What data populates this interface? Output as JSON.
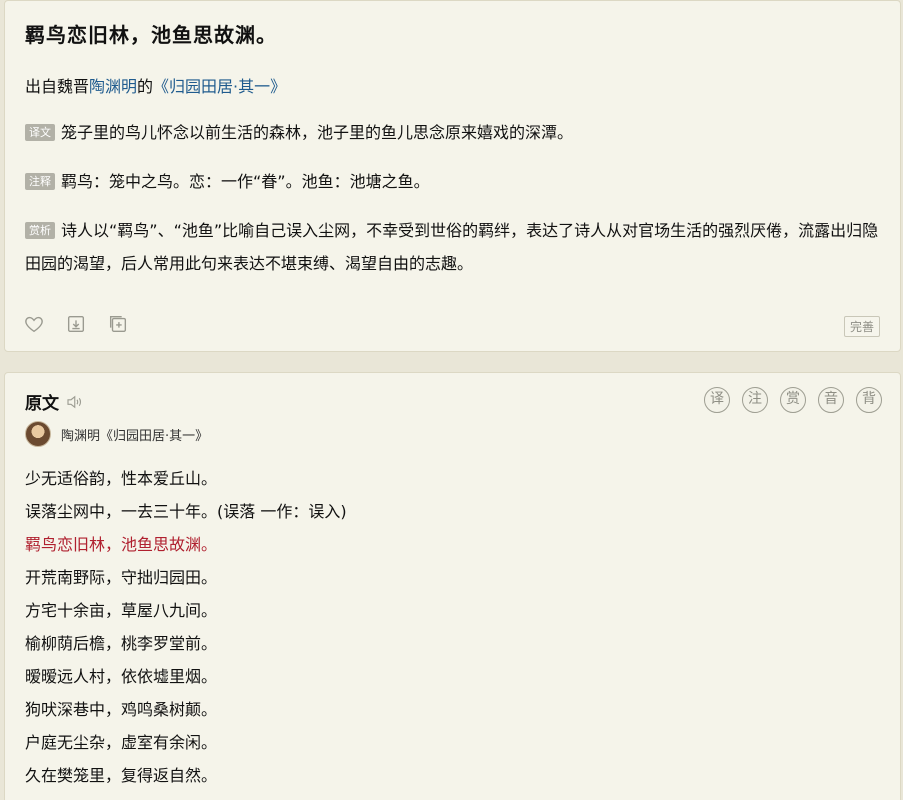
{
  "header": {
    "title": "羁鸟恋旧林，池鱼思故渊。",
    "source_prefix": "出自魏晋",
    "author": "陶渊明",
    "source_mid": "的",
    "work": "《归园田居·其一》"
  },
  "translation": {
    "tag": "译文",
    "text": "笼子里的鸟儿怀念以前生活的森林，池子里的鱼儿思念原来嬉戏的深潭。"
  },
  "note": {
    "tag": "注释",
    "text": "羁鸟：笼中之鸟。恋：一作“眷”。池鱼：池塘之鱼。"
  },
  "appreciation": {
    "tag": "赏析",
    "text": "诗人以“羁鸟”、“池鱼”比喻自己误入尘网，不幸受到世俗的羁绊，表达了诗人从对官场生活的强烈厌倦，流露出归隐田园的渴望，后人常用此句来表达不堪束缚、渴望自由的志趣。"
  },
  "actions": {
    "icons": [
      "heart-icon",
      "download-icon",
      "copy-icon"
    ],
    "perfect_label": "完善"
  },
  "original": {
    "title": "原文",
    "func_buttons": [
      "译",
      "注",
      "赏",
      "音",
      "背"
    ],
    "author_line": "陶渊明《归园田居·其一》",
    "lines": [
      "少无适俗韵，性本爱丘山。",
      "误落尘网中，一去三十年。(误落 一作：误入)",
      "羁鸟恋旧林，池鱼思故渊。",
      "开荒南野际，守拙归园田。",
      "方宅十余亩，草屋八九间。",
      "榆柳荫后檐，桃李罗堂前。",
      "暧暧远人村，依依墟里烟。",
      "狗吠深巷中，鸡鸣桑树颠。",
      "户庭无尘杂，虚室有余闲。",
      "久在樊笼里，复得返自然。"
    ],
    "highlight_line": 2
  },
  "colors": {
    "accent_link": "#1f5b8e",
    "highlight_red": "#b0202f",
    "tag_bg": "#b2b1a7",
    "page_bg": "#e9e6d7",
    "card_bg": "#f5f4ea"
  }
}
